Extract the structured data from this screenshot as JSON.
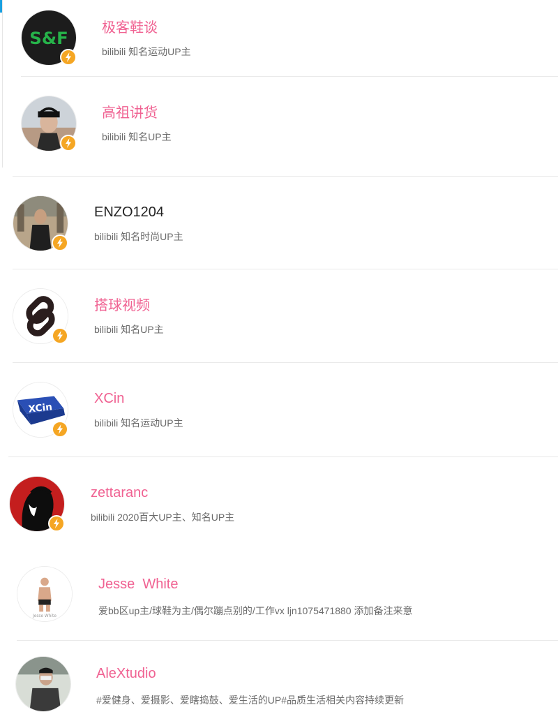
{
  "colors": {
    "name_pink": "#f06292",
    "name_black": "#222222",
    "desc_gray": "#6b6b6b",
    "badge": "#f5a623",
    "accent": "#1aa0e0"
  },
  "users": [
    {
      "name": "极客鞋谈",
      "desc": "bilibili 知名运动UP主",
      "avatar_icon": "sgf-logo-avatar",
      "badge_icon": "lightning-badge-icon",
      "name_color": "pink"
    },
    {
      "name": "高祖讲货",
      "desc": "bilibili 知名UP主",
      "avatar_icon": "person-cap-avatar",
      "badge_icon": "lightning-badge-icon",
      "name_color": "pink"
    },
    {
      "name": "ENZO1204",
      "desc": "bilibili 知名时尚UP主",
      "avatar_icon": "person-street-avatar",
      "badge_icon": "lightning-badge-icon",
      "name_color": "black"
    },
    {
      "name": "搭球视频",
      "desc": "bilibili 知名UP主",
      "avatar_icon": "link-logo-avatar",
      "badge_icon": "lightning-badge-icon",
      "name_color": "pink"
    },
    {
      "name": "XCin",
      "desc": "bilibili 知名运动UP主",
      "avatar_icon": "xcin-logo-avatar",
      "badge_icon": "lightning-badge-icon",
      "name_color": "pink"
    },
    {
      "name": "zettaranc",
      "desc": "bilibili 2020百大UP主、知名UP主",
      "avatar_icon": "silhouette-avatar",
      "badge_icon": "lightning-badge-icon",
      "name_color": "pink"
    },
    {
      "name": "Jesse  White",
      "desc": "爱bb区up主/球鞋为主/偶尔蹦点别的/工作vx ljn1075471880 添加备注来意",
      "avatar_icon": "figure-avatar",
      "name_color": "pink"
    },
    {
      "name": "AleXtudio",
      "desc": "#爱健身、爱摄影、爱瞎捣鼓、爱生活的UP#品质生活相关内容持续更新",
      "avatar_icon": "person-gym-avatar",
      "name_color": "pink"
    }
  ]
}
